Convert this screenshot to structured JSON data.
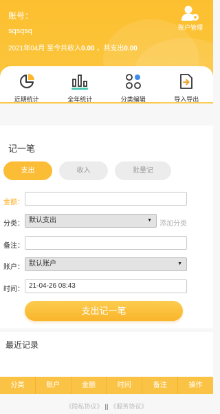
{
  "header": {
    "account_label": "账号：",
    "account_name": "sqsqsq",
    "summary_prefix": "2021年04月  至今共收入",
    "income": "0.00",
    "summary_middle": " ，共支出",
    "expense": "0.00",
    "manage_label": "账户管理",
    "color": "#fcbf2f"
  },
  "nav": [
    {
      "label": "近期统计",
      "icon": "pie-chart-icon"
    },
    {
      "label": "全年统计",
      "icon": "bar-chart-icon"
    },
    {
      "label": "分类编辑",
      "icon": "category-grid-icon"
    },
    {
      "label": "导入导出",
      "icon": "import-export-icon"
    }
  ],
  "form": {
    "title": "记一笔",
    "tabs": [
      "支出",
      "收入",
      "批量记"
    ],
    "amount_label": "金额：",
    "amount_value": "",
    "category_label": "分类：",
    "category_value": "默认支出",
    "add_category": "添加分类",
    "note_label": "备注：",
    "note_value": "",
    "account_label": "账户：",
    "account_value": "默认账户",
    "time_label": "时间：",
    "time_value": "21-04-26 08:43",
    "submit_label": "支出记一笔"
  },
  "recent": {
    "title": "最近记录",
    "columns": [
      "分类",
      "账户",
      "金额",
      "时间",
      "备注",
      "操作"
    ]
  },
  "footer": {
    "privacy": "《隐私协议》",
    "separator": "||",
    "service": "《服务协议》"
  }
}
